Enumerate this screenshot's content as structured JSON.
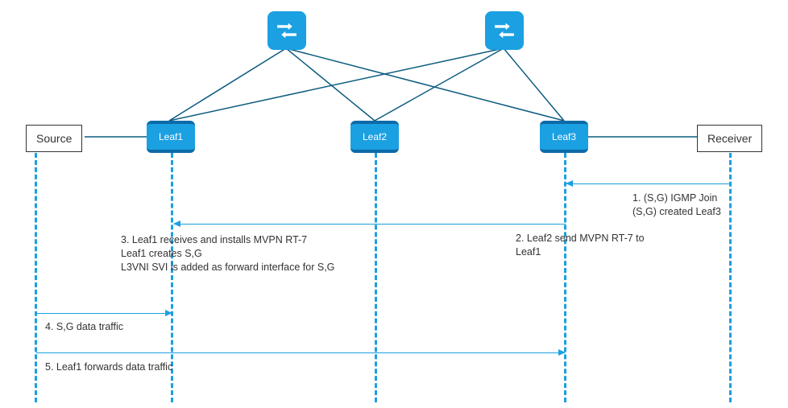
{
  "topology": {
    "spines": [
      {
        "id": "spine-1"
      },
      {
        "id": "spine-2"
      }
    ],
    "leaves": [
      {
        "id": "leaf-1",
        "label": "Leaf1"
      },
      {
        "id": "leaf-2",
        "label": "Leaf2"
      },
      {
        "id": "leaf-3",
        "label": "Leaf3"
      }
    ],
    "hosts": {
      "source": "Source",
      "receiver": "Receiver"
    }
  },
  "steps": {
    "s1_line1": "1. (S,G) IGMP Join",
    "s1_line2": "(S,G) created Leaf3",
    "s2_line1": "2. Leaf2 send MVPN RT-7 to",
    "s2_line2": "Leaf1",
    "s3_line1": "3. Leaf1 receives and installs MVPN RT-7",
    "s3_line2": "Leaf1 creates S,G",
    "s3_line3": "L3VNI SVI is added as forward interface for S,G",
    "s4": "4. S,G data traffic",
    "s5": "5. Leaf1 forwards data traffic"
  },
  "colors": {
    "accent": "#1ba0e2",
    "dark": "#0d5c7f"
  }
}
